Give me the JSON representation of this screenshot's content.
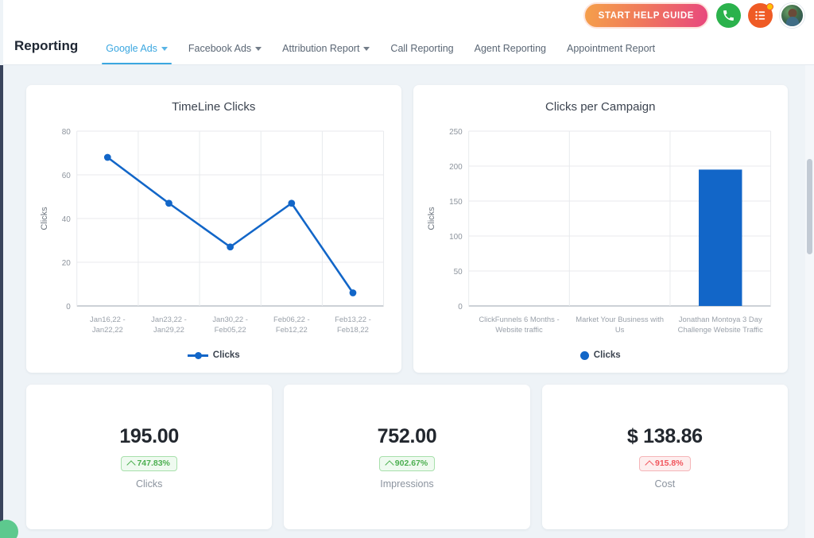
{
  "header": {
    "page_title": "Reporting",
    "help_button_label": "START HELP GUIDE",
    "phone_icon": "phone-icon",
    "tasks_icon": "tasks-list-icon",
    "avatar": "user-avatar",
    "tabs": [
      {
        "label": "Google Ads",
        "has_caret": true,
        "active": true
      },
      {
        "label": "Facebook Ads",
        "has_caret": true,
        "active": false
      },
      {
        "label": "Attribution Report",
        "has_caret": true,
        "active": false
      },
      {
        "label": "Call Reporting",
        "has_caret": false,
        "active": false
      },
      {
        "label": "Agent Reporting",
        "has_caret": false,
        "active": false
      },
      {
        "label": "Appointment Report",
        "has_caret": false,
        "active": false
      }
    ]
  },
  "colors": {
    "accent_blue": "#1266c8",
    "tab_active": "#3ba7e0",
    "positive_green": "#4caf50",
    "negative_red": "#f1555c",
    "page_bg": "#eef3f7"
  },
  "chart_data": [
    {
      "type": "line",
      "title": "TimeLine Clicks",
      "xlabel": "",
      "ylabel": "Clicks",
      "categories": [
        "Jan16,22 - Jan22,22",
        "Jan23,22 - Jan29,22",
        "Jan30,22 - Feb05,22",
        "Feb06,22 - Feb12,22",
        "Feb13,22 - Feb18,22"
      ],
      "tick_lines": [
        [
          "Jan16,22 -",
          "Jan22,22"
        ],
        [
          "Jan23,22 -",
          "Jan29,22"
        ],
        [
          "Jan30,22 -",
          "Feb05,22"
        ],
        [
          "Feb06,22 -",
          "Feb12,22"
        ],
        [
          "Feb13,22 -",
          "Feb18,22"
        ]
      ],
      "values": [
        68,
        47,
        27,
        47,
        6
      ],
      "yticks": [
        0,
        20,
        40,
        60,
        80
      ],
      "ylim": [
        0,
        80
      ],
      "grid": true,
      "legend": [
        "Clicks"
      ],
      "legend_position": "bottom",
      "series_color": "#1266c8"
    },
    {
      "type": "bar",
      "title": "Clicks per Campaign",
      "xlabel": "",
      "ylabel": "Clicks",
      "categories": [
        "ClickFunnels 6 Months - Website traffic",
        "Market Your Business with Us",
        "Jonathan Montoya 3 Day Challenge Website Traffic"
      ],
      "tick_lines": [
        [
          "ClickFunnels 6 Months -",
          "Website traffic"
        ],
        [
          "Market Your Business with",
          "Us"
        ],
        [
          "Jonathan Montoya 3 Day",
          "Challenge Website Traffic"
        ]
      ],
      "values": [
        0,
        0,
        195
      ],
      "yticks": [
        0,
        50,
        100,
        150,
        200,
        250
      ],
      "ylim": [
        0,
        250
      ],
      "grid": true,
      "legend": [
        "Clicks"
      ],
      "legend_position": "bottom",
      "series_color": "#1266c8"
    }
  ],
  "metrics": [
    {
      "value": "195.00",
      "change": "747.83%",
      "direction": "up",
      "tone": "green",
      "label": "Clicks"
    },
    {
      "value": "752.00",
      "change": "902.67%",
      "direction": "up",
      "tone": "green",
      "label": "Impressions"
    },
    {
      "value": "$ 138.86",
      "change": "915.8%",
      "direction": "up",
      "tone": "red",
      "label": "Cost"
    }
  ],
  "scrollbar": {
    "name": "vertical-scrollbar"
  },
  "chat_widget": {
    "name": "chat-launcher"
  }
}
